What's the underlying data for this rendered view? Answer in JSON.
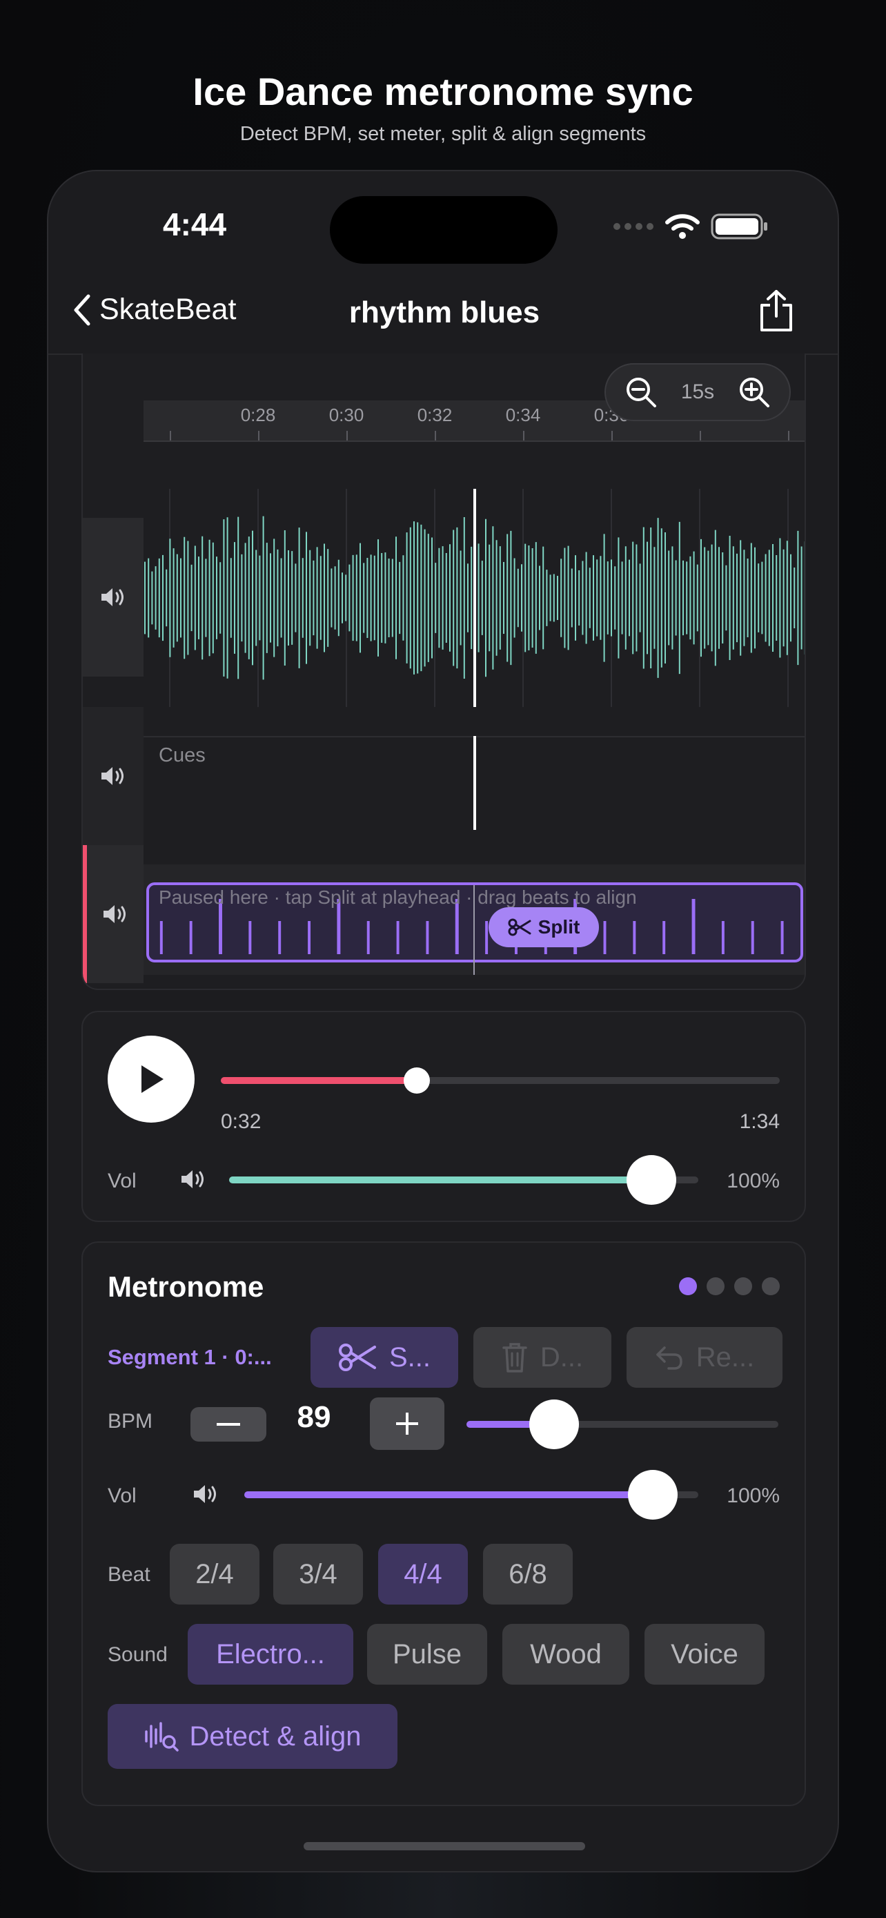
{
  "header": {
    "title": "Ice Dance metronome sync",
    "subtitle": "Detect BPM, set meter, split & align segments"
  },
  "status_bar": {
    "time": "4:44"
  },
  "nav": {
    "back_label": "SkateBeat",
    "title": "rhythm blues"
  },
  "timeline": {
    "ruler_labels": [
      "0:28",
      "0:30",
      "0:32",
      "0:34",
      "0:36"
    ],
    "zoom_label": "15s",
    "cues_label": "Cues",
    "beat_hint": "Paused here · tap Split at playhead · drag beats to align",
    "split_label": "Split"
  },
  "playback": {
    "current_time": "0:32",
    "total_time": "1:34",
    "progress": 0.35,
    "vol_label": "Vol",
    "volume_percent": "100%",
    "volume_level": 0.9
  },
  "metronome": {
    "title": "Metronome",
    "page_dots": 4,
    "active_dot": 0,
    "segment_label": "Segment 1 · 0:...",
    "split_button": "S...",
    "delete_button": "D...",
    "revert_button": "Re...",
    "bpm_label": "BPM",
    "bpm_value": "89",
    "bpm_slider_level": 0.28,
    "vol_label": "Vol",
    "volume_percent": "100%",
    "volume_level": 0.9,
    "beat_label": "Beat",
    "beat_options": [
      "2/4",
      "3/4",
      "4/4",
      "6/8"
    ],
    "beat_selected": "4/4",
    "sound_label": "Sound",
    "sound_options": [
      "Electro...",
      "Pulse",
      "Wood",
      "Voice"
    ],
    "sound_selected": "Electro...",
    "detect_button": "Detect & align"
  },
  "colors": {
    "accent_purple": "#9b6ef6",
    "waveform_teal": "#7fd6c4",
    "seek_red": "#f0506e"
  }
}
